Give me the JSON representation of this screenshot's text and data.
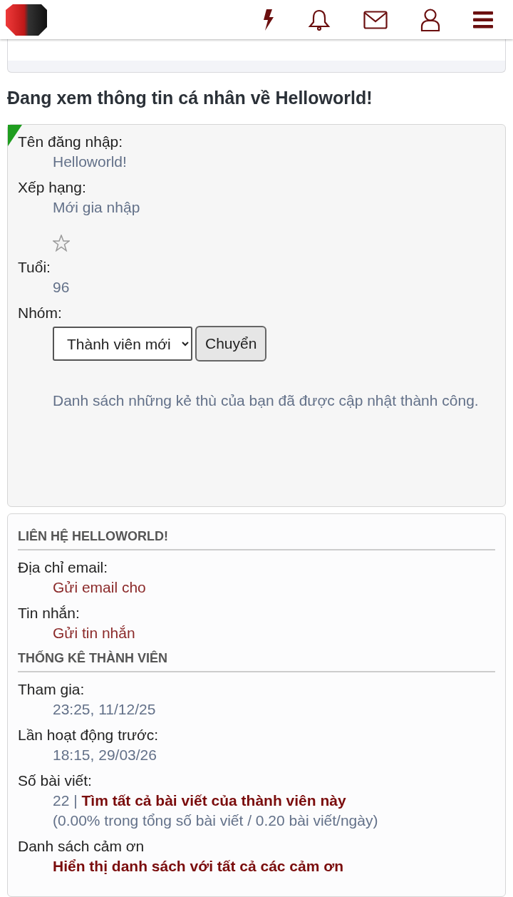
{
  "heading": "Đang xem thông tin cá nhân về Helloworld!",
  "profile": {
    "online": true,
    "fields": [
      {
        "kind": "text",
        "label": "Tên đăng nhập:",
        "value": "Helloworld!"
      },
      {
        "kind": "rank",
        "label": "Xếp hạng:",
        "value": "Mới gia nhập"
      },
      {
        "kind": "text",
        "label": "Tuổi:",
        "value": "96"
      },
      {
        "kind": "group",
        "label": "Nhóm:",
        "select": "Thành viên mới",
        "button": "Chuyển"
      }
    ],
    "message": "Danh sách những kẻ thù của bạn đã được cập nhật thành công."
  },
  "sections": [
    {
      "title": "LIÊN HỆ HELLOWORLD!",
      "fields": [
        {
          "label": "Địa chỉ email:",
          "link": {
            "text": "Gửi email cho",
            "strong": false
          }
        },
        {
          "label": "Tin nhắn:",
          "link": {
            "text": "Gửi tin nhắn",
            "strong": false
          }
        }
      ]
    },
    {
      "title": "THỐNG KÊ THÀNH VIÊN",
      "fields": [
        {
          "label": "Tham gia:",
          "value": "23:25, 11/12/25"
        },
        {
          "label": "Lần hoạt động trước:",
          "value": "18:15, 29/03/26"
        },
        {
          "label": "Số bài viết:",
          "value": "22 |",
          "link": {
            "text": "Tìm tất cả bài viết của thành viên này",
            "strong": true
          },
          "note": "(0.00% trong tổng số bài viết / 0.20 bài viết/ngày)"
        },
        {
          "label": "Danh sách cảm ơn",
          "link": {
            "text": "Hiển thị danh sách với tất cả các cảm ơn",
            "strong": true
          }
        }
      ]
    }
  ]
}
